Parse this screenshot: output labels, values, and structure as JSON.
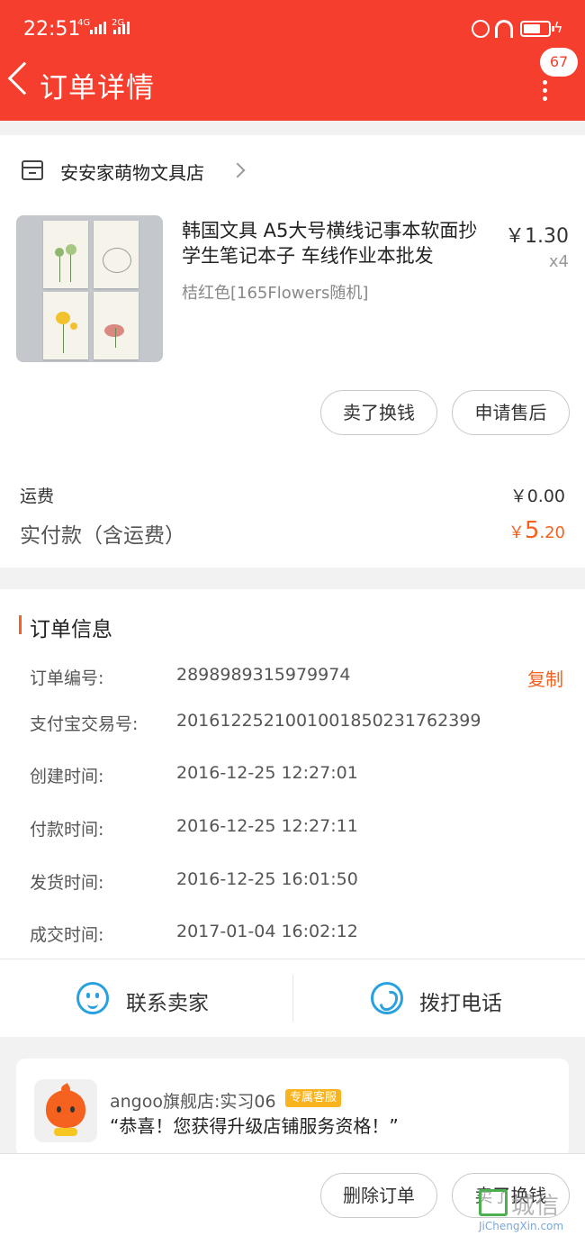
{
  "status_bar": {
    "time": "22:51",
    "net1": "4G",
    "net2": "2G",
    "colors": {
      "bar": "#f53e2d"
    }
  },
  "header": {
    "title": "订单详情",
    "badge_count": "67"
  },
  "shop": {
    "name": "安安家萌物文具店"
  },
  "product": {
    "title": "韩国文具 A5大号横线记事本软面抄 学生笔记本子 车线作业本批发",
    "price": "￥1.30",
    "quantity": "x4",
    "variant": "桔红色[165Flowers随机]"
  },
  "product_actions": {
    "sell_label": "卖了换钱",
    "after_sale_label": "申请售后"
  },
  "summary": {
    "shipping_label": "运费",
    "shipping_value": "￥0.00",
    "total_label": "实付款（含运费）",
    "total_symbol": "￥",
    "total_int": "5",
    "total_dec": ".20",
    "accent_color": "#f5611f"
  },
  "order_info": {
    "section_title": "订单信息",
    "copy_label": "复制",
    "rows": [
      {
        "label": "订单编号:",
        "value": "2898989315979974"
      },
      {
        "label": "支付宝交易号:",
        "value": "2016122521001001850231762399"
      },
      {
        "label": "创建时间:",
        "value": "2016-12-25 12:27:01"
      },
      {
        "label": "付款时间:",
        "value": "2016-12-25 12:27:11"
      },
      {
        "label": "发货时间:",
        "value": "2016-12-25 16:01:50"
      },
      {
        "label": "成交时间:",
        "value": "2017-01-04 16:02:12"
      }
    ]
  },
  "contact": {
    "contact_seller_label": "联系卖家",
    "call_label": "拨打电话",
    "icon_color": "#29a0e0"
  },
  "chat": {
    "name": "angoo旗舰店:实习06",
    "tag": "专属客服",
    "message": "“恭喜！您获得升级店铺服务资格！”"
  },
  "bottom_actions": {
    "delete_label": "删除订单",
    "sell_label": "卖了换钱"
  },
  "watermark": {
    "text": "城信",
    "url": "JiChengXin.com"
  }
}
